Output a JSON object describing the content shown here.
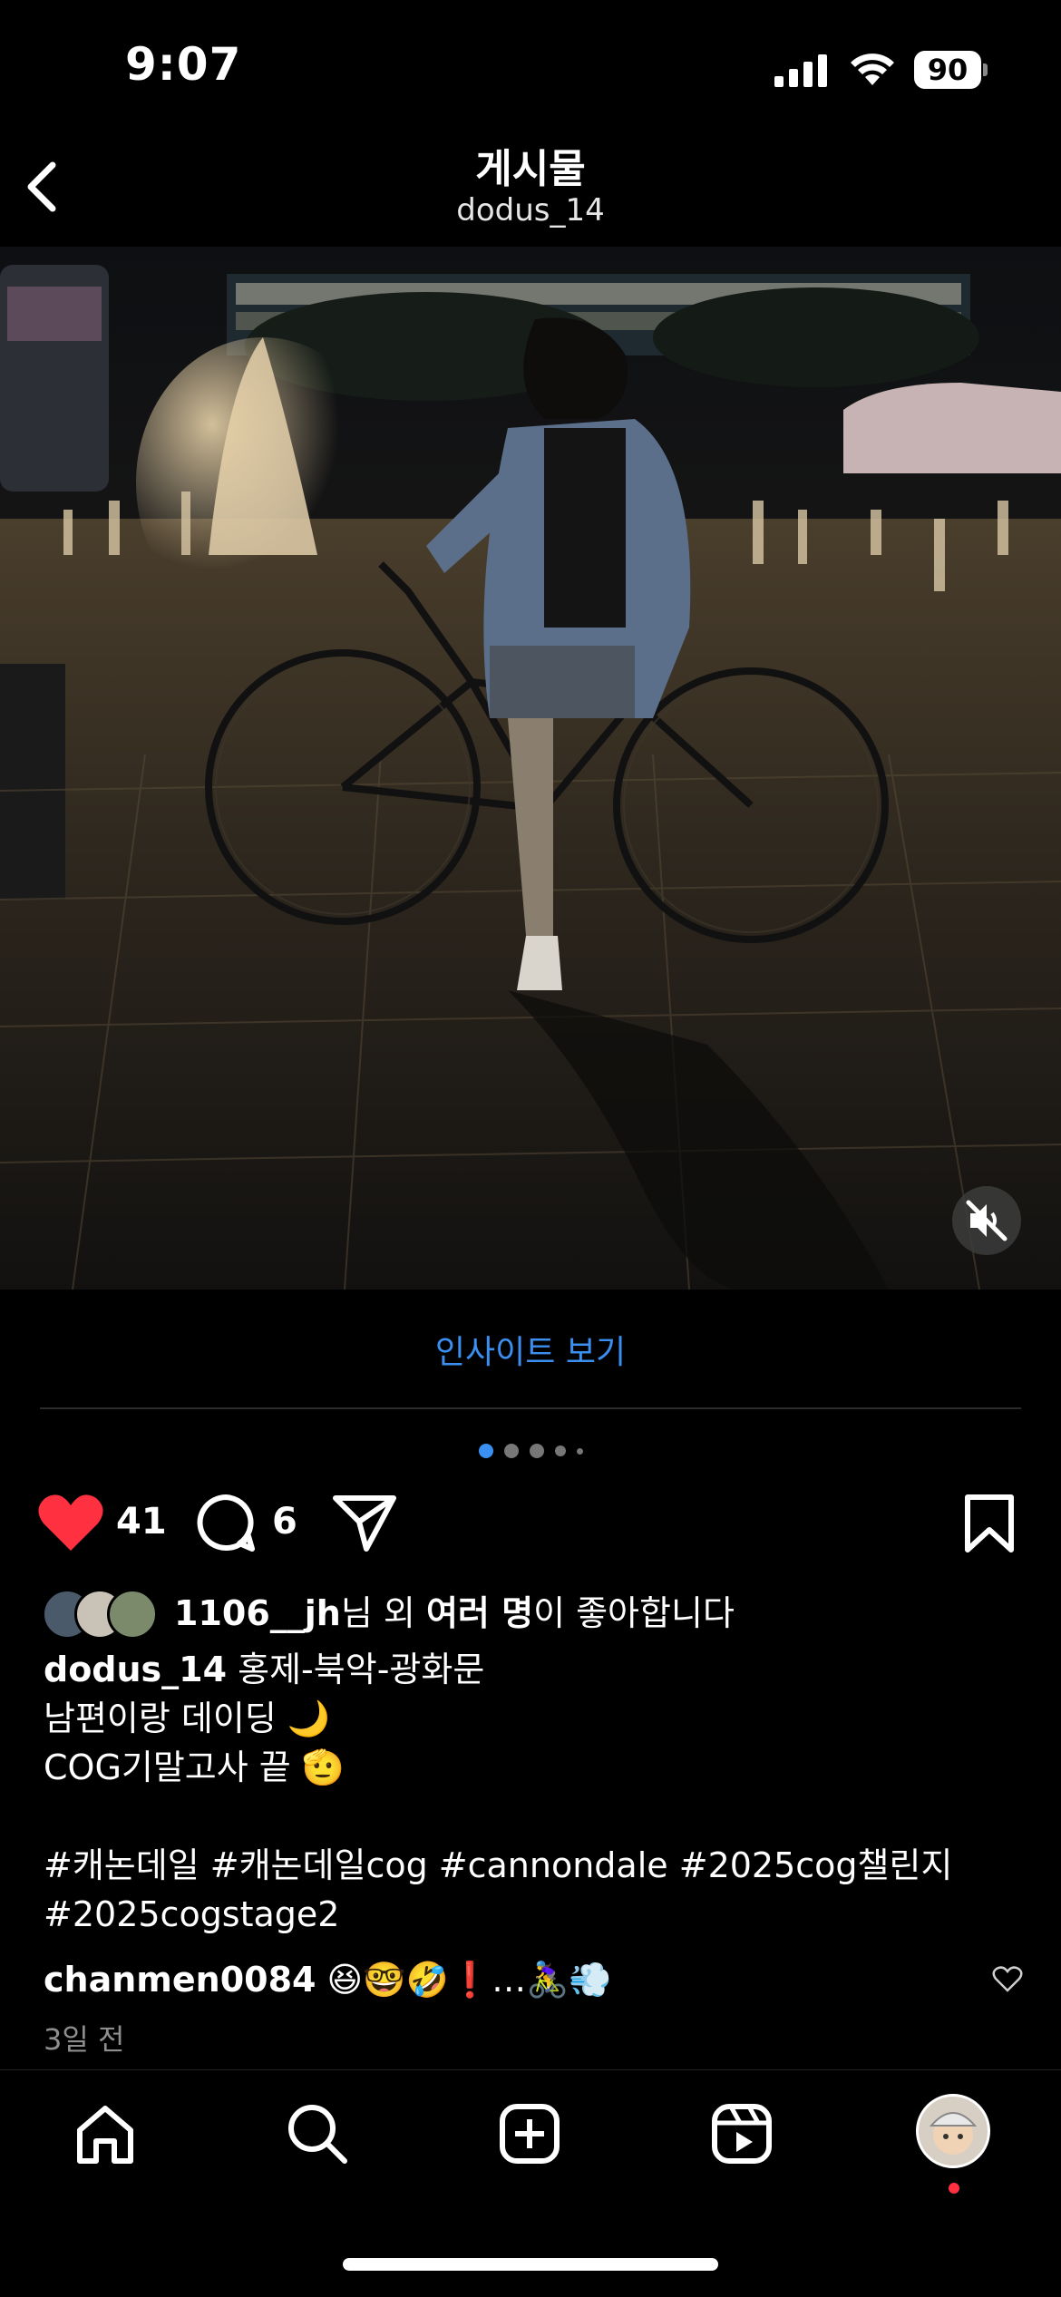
{
  "status_bar": {
    "time": "9:07",
    "battery": "90"
  },
  "header": {
    "title": "게시물",
    "subtitle": "dodus_14"
  },
  "post": {
    "insight_label": "인사이트 보기",
    "carousel": {
      "count": 5,
      "active": 0
    },
    "likes_count": "41",
    "comments_count": "6",
    "liked_by": {
      "user": "1106__jh",
      "suffix1": "님 외 ",
      "others": "여러 명",
      "suffix2": "이 좋아합니다"
    },
    "caption": {
      "username": "dodus_14",
      "line1": " 홍제-북악-광화문",
      "line2": "남편이랑 데이딩 🌙",
      "line3": "COG기말고사 끝 🫡",
      "hashtags1": "#캐논데일 #캐논데일cog #cannondale #2025cog챌린지",
      "hashtags2": "#2025cogstage2"
    },
    "comment": {
      "username": "chanmen0084",
      "text": " 😆🤓🤣❗…🚴‍♀️💨"
    },
    "timestamp": "3일 전"
  },
  "nav": {
    "items": [
      "home-icon",
      "search-icon",
      "create-icon",
      "reels-icon",
      "profile-avatar"
    ]
  },
  "colors": {
    "accent": "#3b8ff0",
    "like": "#ff3040",
    "notification": "#ff3040"
  }
}
